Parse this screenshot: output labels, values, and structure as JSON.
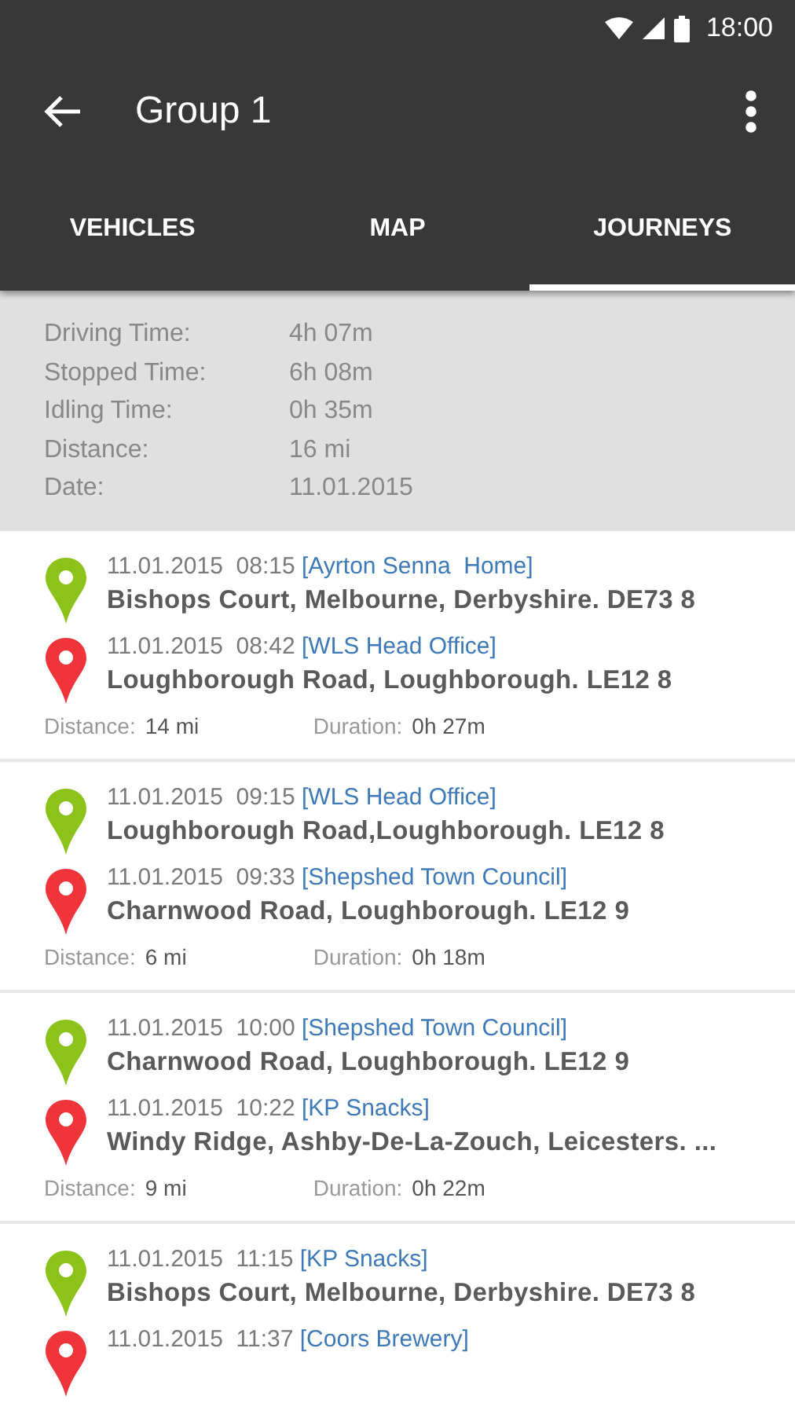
{
  "status_bar": {
    "time": "18:00"
  },
  "toolbar": {
    "title": "Group 1"
  },
  "tabs": [
    {
      "label": "VEHICLES",
      "selected": false
    },
    {
      "label": "MAP",
      "selected": false
    },
    {
      "label": "JOURNEYS",
      "selected": true
    }
  ],
  "summary": [
    {
      "label": "Driving Time:",
      "value": "4h 07m"
    },
    {
      "label": "Stopped Time:",
      "value": "6h 08m"
    },
    {
      "label": "Idling Time:",
      "value": "0h 35m"
    },
    {
      "label": "Distance:",
      "value": "16 mi"
    },
    {
      "label": "Date:",
      "value": "11.01.2015"
    }
  ],
  "journeys": [
    {
      "stops": [
        {
          "kind": "start",
          "datetime": "11.01.2015  08:15 ",
          "place": "[Ayrton Senna  Home]",
          "address": "Bishops Court, Melbourne, Derbyshire. DE73 8"
        },
        {
          "kind": "end",
          "datetime": "11.01.2015  08:42 ",
          "place": "[WLS Head Office]",
          "address": "Loughborough Road, Loughborough. LE12 8"
        }
      ],
      "distance_label": "Distance:",
      "distance": "14 mi",
      "duration_label": "Duration:",
      "duration": "0h 27m"
    },
    {
      "stops": [
        {
          "kind": "start",
          "datetime": "11.01.2015  09:15 ",
          "place": "[WLS Head Office]",
          "address": "Loughborough Road,Loughborough. LE12 8"
        },
        {
          "kind": "end",
          "datetime": "11.01.2015  09:33 ",
          "place": "[Shepshed Town Council]",
          "address": "Charnwood Road, Loughborough. LE12 9"
        }
      ],
      "distance_label": "Distance:",
      "distance": "6 mi",
      "duration_label": "Duration:",
      "duration": "0h 18m"
    },
    {
      "stops": [
        {
          "kind": "start",
          "datetime": "11.01.2015  10:00 ",
          "place": "[Shepshed Town Council]",
          "address": "Charnwood Road, Loughborough. LE12 9"
        },
        {
          "kind": "end",
          "datetime": "11.01.2015  10:22 ",
          "place": "[KP Snacks]",
          "address": "Windy Ridge, Ashby-De-La-Zouch, Leicesters. ..."
        }
      ],
      "distance_label": "Distance:",
      "distance": "9 mi",
      "duration_label": "Duration:",
      "duration": "0h 22m"
    },
    {
      "stops": [
        {
          "kind": "start",
          "datetime": "11.01.2015  11:15 ",
          "place": "[KP Snacks]",
          "address": "Bishops Court, Melbourne, Derbyshire. DE73 8"
        },
        {
          "kind": "end",
          "datetime": "11.01.2015  11:37 ",
          "place": "[Coors Brewery]"
        }
      ]
    }
  ]
}
